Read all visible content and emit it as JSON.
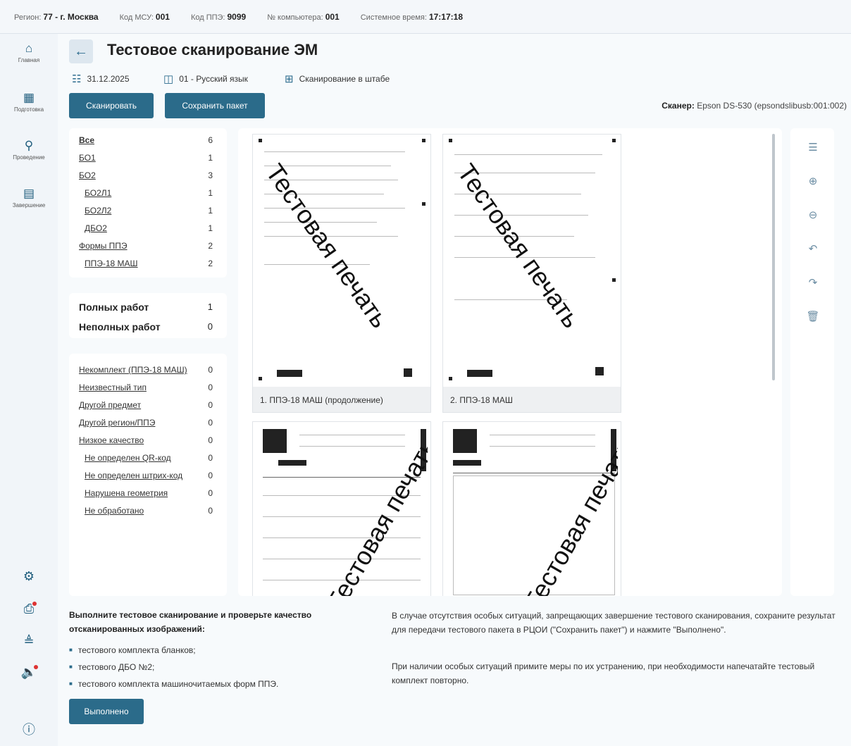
{
  "topbar": {
    "region_label": "Регион:",
    "region_value": "77 - г. Москва",
    "msu_label": "Код МСУ:",
    "msu_value": "001",
    "ppe_label": "Код ППЭ:",
    "ppe_value": "9099",
    "comp_label": "№ компьютера:",
    "comp_value": "001",
    "time_label": "Системное время:",
    "time_value": "17:17:18"
  },
  "nav": {
    "main": "Главная",
    "prep": "Подготовка",
    "conduct": "Проведение",
    "finish": "Завершение"
  },
  "header": {
    "title": "Тестовое сканирование ЭМ",
    "date": "31.12.2025",
    "subject": "01 - Русский язык",
    "mode": "Сканирование в штабе"
  },
  "buttons": {
    "scan": "Сканировать",
    "save": "Сохранить пакет",
    "done": "Выполнено"
  },
  "scanner": {
    "label": "Сканер:",
    "value": "Epson DS-530 (epsondslibusb:001:002)"
  },
  "filters": [
    {
      "label": "Все",
      "count": "6"
    },
    {
      "label": "БО1",
      "count": "1"
    },
    {
      "label": "БО2",
      "count": "3"
    },
    {
      "label": "БО2Л1",
      "count": "1"
    },
    {
      "label": "БО2Л2",
      "count": "1"
    },
    {
      "label": "ДБО2",
      "count": "1"
    },
    {
      "label": "Формы ППЭ",
      "count": "2"
    },
    {
      "label": "ППЭ-18 МАШ",
      "count": "2"
    }
  ],
  "stats": [
    {
      "label": "Полных работ",
      "count": "1"
    },
    {
      "label": "Неполных работ",
      "count": "0"
    }
  ],
  "issues": [
    {
      "label": "Некомплект (ППЭ-18 МАШ)",
      "count": "0"
    },
    {
      "label": "Неизвестный тип",
      "count": "0"
    },
    {
      "label": "Другой предмет",
      "count": "0"
    },
    {
      "label": "Другой регион/ППЭ",
      "count": "0"
    },
    {
      "label": "Низкое качество",
      "count": "0"
    },
    {
      "label": "Не определен QR-код",
      "count": "0"
    },
    {
      "label": "Не определен штрих-код",
      "count": "0"
    },
    {
      "label": "Нарушена геометрия",
      "count": "0"
    },
    {
      "label": "Не обработано",
      "count": "0"
    }
  ],
  "thumbs": [
    {
      "caption": "1. ППЭ-18 МАШ (продолжение)"
    },
    {
      "caption": "2. ППЭ-18 МАШ"
    }
  ],
  "watermark": "Тестовая печать",
  "footer": {
    "title": "Выполните тестовое сканирование и проверьте качество отсканированных изображений:",
    "bullet1": "тестового комплекта бланков;",
    "bullet2": "тестового ДБО №2;",
    "bullet3": "тестового комплекта машиночитаемых форм ППЭ.",
    "note1": "В случае отсутствия особых ситуаций, запрещающих завершение тестового сканирования, сохраните результат для передачи тестового пакета в РЦОИ (\"Сохранить пакет\") и нажмите \"Выполнено\".",
    "note2": "При наличии особых ситуаций примите меры по их устранению, при необходимости напечатайте тестовый комплект повторно."
  }
}
